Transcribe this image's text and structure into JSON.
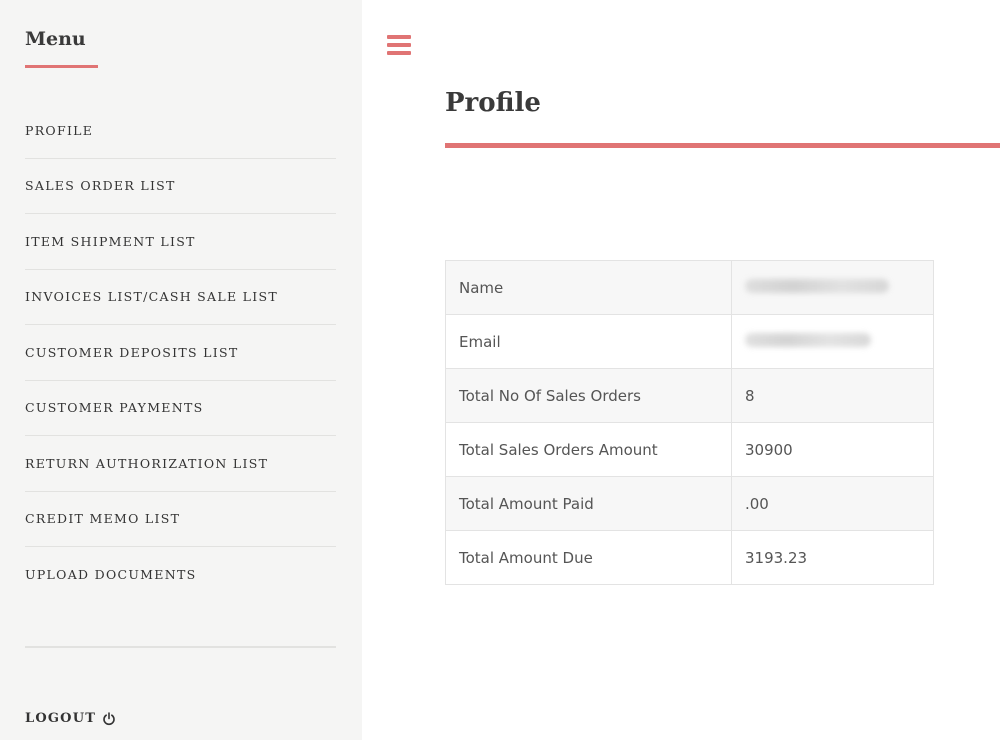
{
  "sidebar": {
    "title": "Menu",
    "items": [
      {
        "label": "PROFILE"
      },
      {
        "label": "SALES ORDER LIST"
      },
      {
        "label": "ITEM SHIPMENT LIST"
      },
      {
        "label": "INVOICES LIST/CASH SALE LIST"
      },
      {
        "label": "CUSTOMER DEPOSITS LIST"
      },
      {
        "label": "CUSTOMER PAYMENTS"
      },
      {
        "label": "RETURN AUTHORIZATION LIST"
      },
      {
        "label": "CREDIT MEMO LIST"
      },
      {
        "label": "UPLOAD DOCUMENTS"
      }
    ],
    "logout_label": "LOGOUT",
    "logout_icon": "power-icon"
  },
  "header": {
    "menu_icon": "hamburger-icon"
  },
  "main": {
    "title": "Profile",
    "profile_rows": [
      {
        "label": "Name",
        "value": "",
        "redacted": true
      },
      {
        "label": "Email",
        "value": "",
        "redacted": true
      },
      {
        "label": "Total No Of Sales Orders",
        "value": "8"
      },
      {
        "label": "Total Sales Orders Amount",
        "value": "30900"
      },
      {
        "label": "Total Amount Paid",
        "value": ".00"
      },
      {
        "label": "Total Amount Due",
        "value": "3193.23"
      }
    ]
  },
  "colors": {
    "accent": "#e07474",
    "sidebar_bg": "#f5f5f4",
    "row_alt": "#f7f7f7"
  }
}
